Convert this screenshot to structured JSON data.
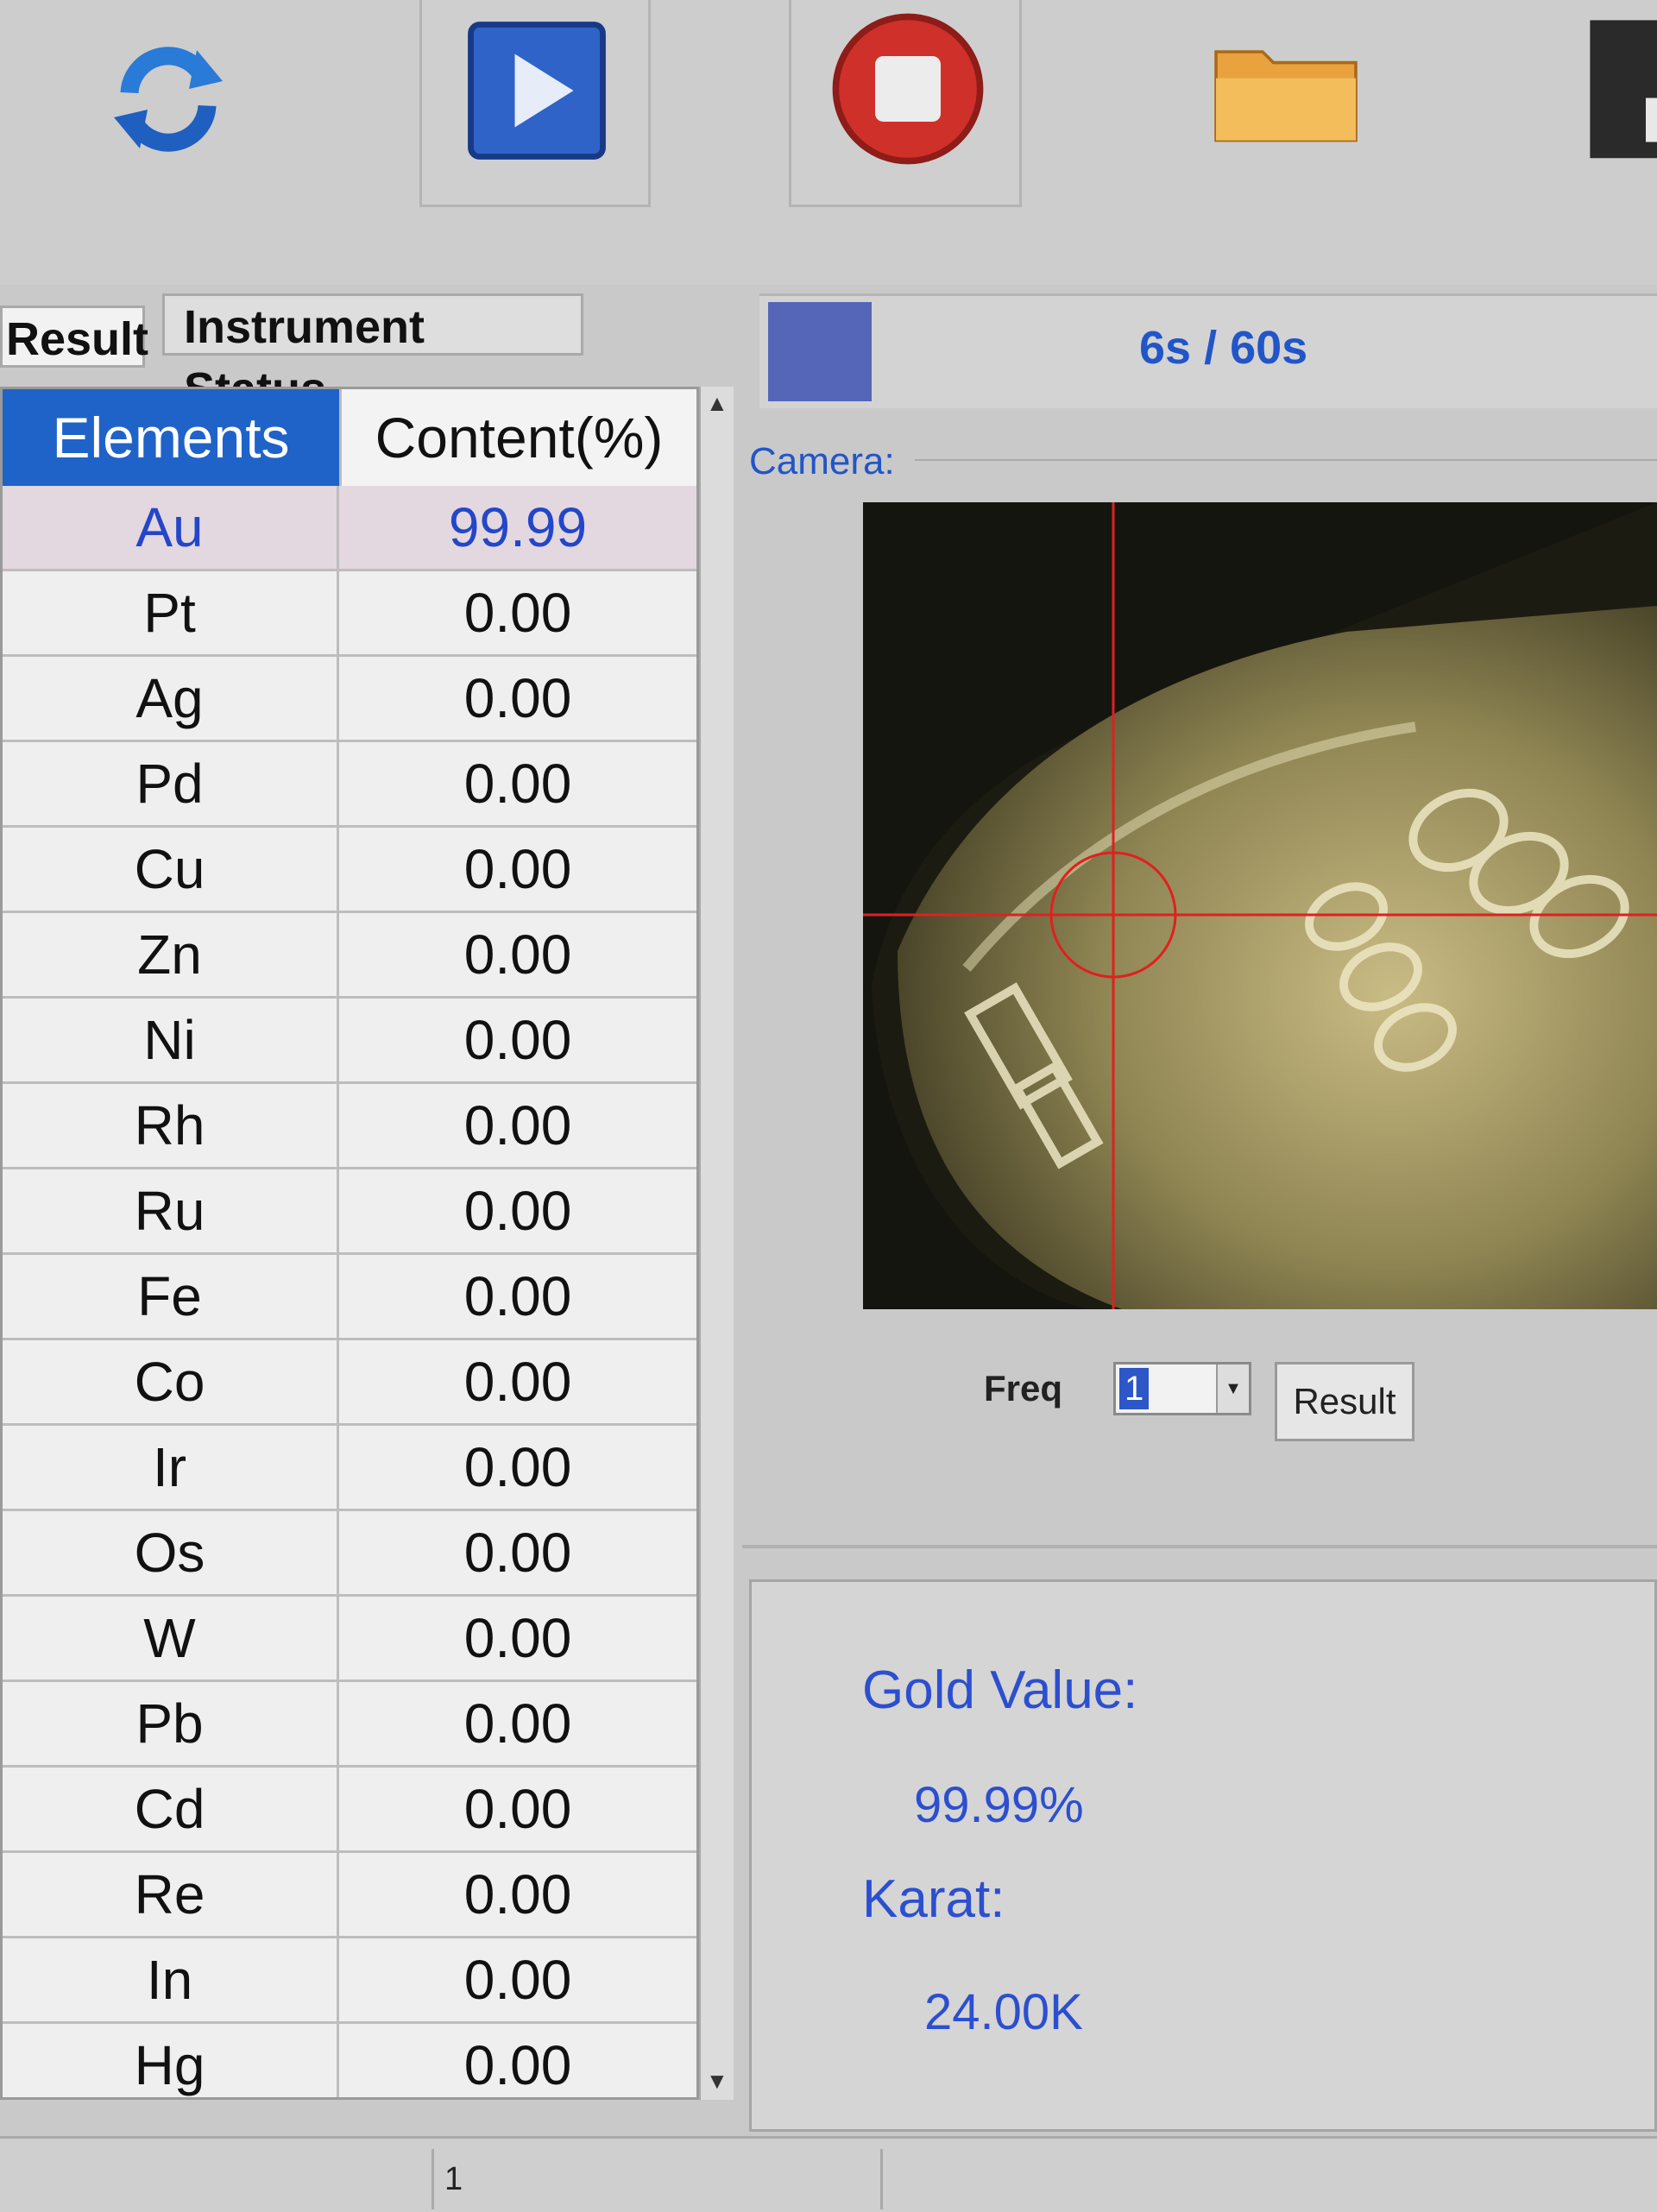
{
  "toolbar": {
    "buttons": [
      {
        "icon": "refresh-icon",
        "color": "#2a7ad8"
      },
      {
        "icon": "play-icon",
        "color": "#2f63c8"
      },
      {
        "icon": "stop-icon",
        "color": "#d0302a"
      },
      {
        "icon": "folder-open-icon",
        "color": "#e9a23e"
      },
      {
        "icon": "save-icon",
        "color": "#2a2a2a"
      }
    ]
  },
  "tabs": [
    "Result",
    "Instrument Status"
  ],
  "table": {
    "headers": {
      "elements": "Elements",
      "content": "Content(%)"
    },
    "rows": [
      {
        "element": "Au",
        "content": "99.99"
      },
      {
        "element": "Pt",
        "content": "0.00"
      },
      {
        "element": "Ag",
        "content": "0.00"
      },
      {
        "element": "Pd",
        "content": "0.00"
      },
      {
        "element": "Cu",
        "content": "0.00"
      },
      {
        "element": "Zn",
        "content": "0.00"
      },
      {
        "element": "Ni",
        "content": "0.00"
      },
      {
        "element": "Rh",
        "content": "0.00"
      },
      {
        "element": "Ru",
        "content": "0.00"
      },
      {
        "element": "Fe",
        "content": "0.00"
      },
      {
        "element": "Co",
        "content": "0.00"
      },
      {
        "element": "Ir",
        "content": "0.00"
      },
      {
        "element": "Os",
        "content": "0.00"
      },
      {
        "element": "W",
        "content": "0.00"
      },
      {
        "element": "Pb",
        "content": "0.00"
      },
      {
        "element": "Cd",
        "content": "0.00"
      },
      {
        "element": "Re",
        "content": "0.00"
      },
      {
        "element": "In",
        "content": "0.00"
      },
      {
        "element": "Hg",
        "content": "0.00"
      }
    ]
  },
  "measurement": {
    "progress_text": "6s / 60s",
    "elapsed_s": 6,
    "total_s": 60
  },
  "camera": {
    "label": "Camera:"
  },
  "freq": {
    "label": "Freq",
    "value": "1",
    "result_button": "Result"
  },
  "gold": {
    "value_label": "Gold Value:",
    "value": "99.99%",
    "karat_label": "Karat:",
    "karat": "24.00K"
  },
  "statusbar": {
    "page": "1"
  },
  "colors": {
    "accent_blue": "#2c4fd0",
    "header_blue": "#1f63c9",
    "crosshair_red": "#e02020"
  }
}
